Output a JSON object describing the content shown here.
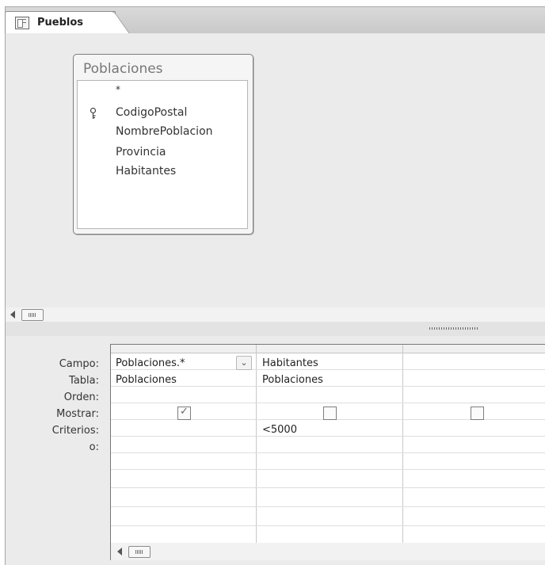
{
  "tab": {
    "title": "Pueblos",
    "icon": "query-design-icon"
  },
  "table": {
    "name": "Poblaciones",
    "fields": [
      "*",
      "CodigoPostal",
      "NombrePoblacion",
      "Provincia",
      "Habitantes"
    ],
    "primary_key_field": "CodigoPostal"
  },
  "grid": {
    "row_labels": [
      "Campo:",
      "Tabla:",
      "Orden:",
      "Mostrar:",
      "Criterios:",
      "o:"
    ],
    "columns": [
      {
        "campo": "Poblaciones.*",
        "tabla": "Poblaciones",
        "orden": "",
        "mostrar": true,
        "criterios": "",
        "o": "",
        "has_dropdown": true
      },
      {
        "campo": "Habitantes",
        "tabla": "Poblaciones",
        "orden": "",
        "mostrar": false,
        "criterios": "<5000",
        "o": ""
      },
      {
        "campo": "",
        "tabla": "",
        "orden": "",
        "mostrar": false,
        "criterios": "",
        "o": ""
      }
    ]
  }
}
